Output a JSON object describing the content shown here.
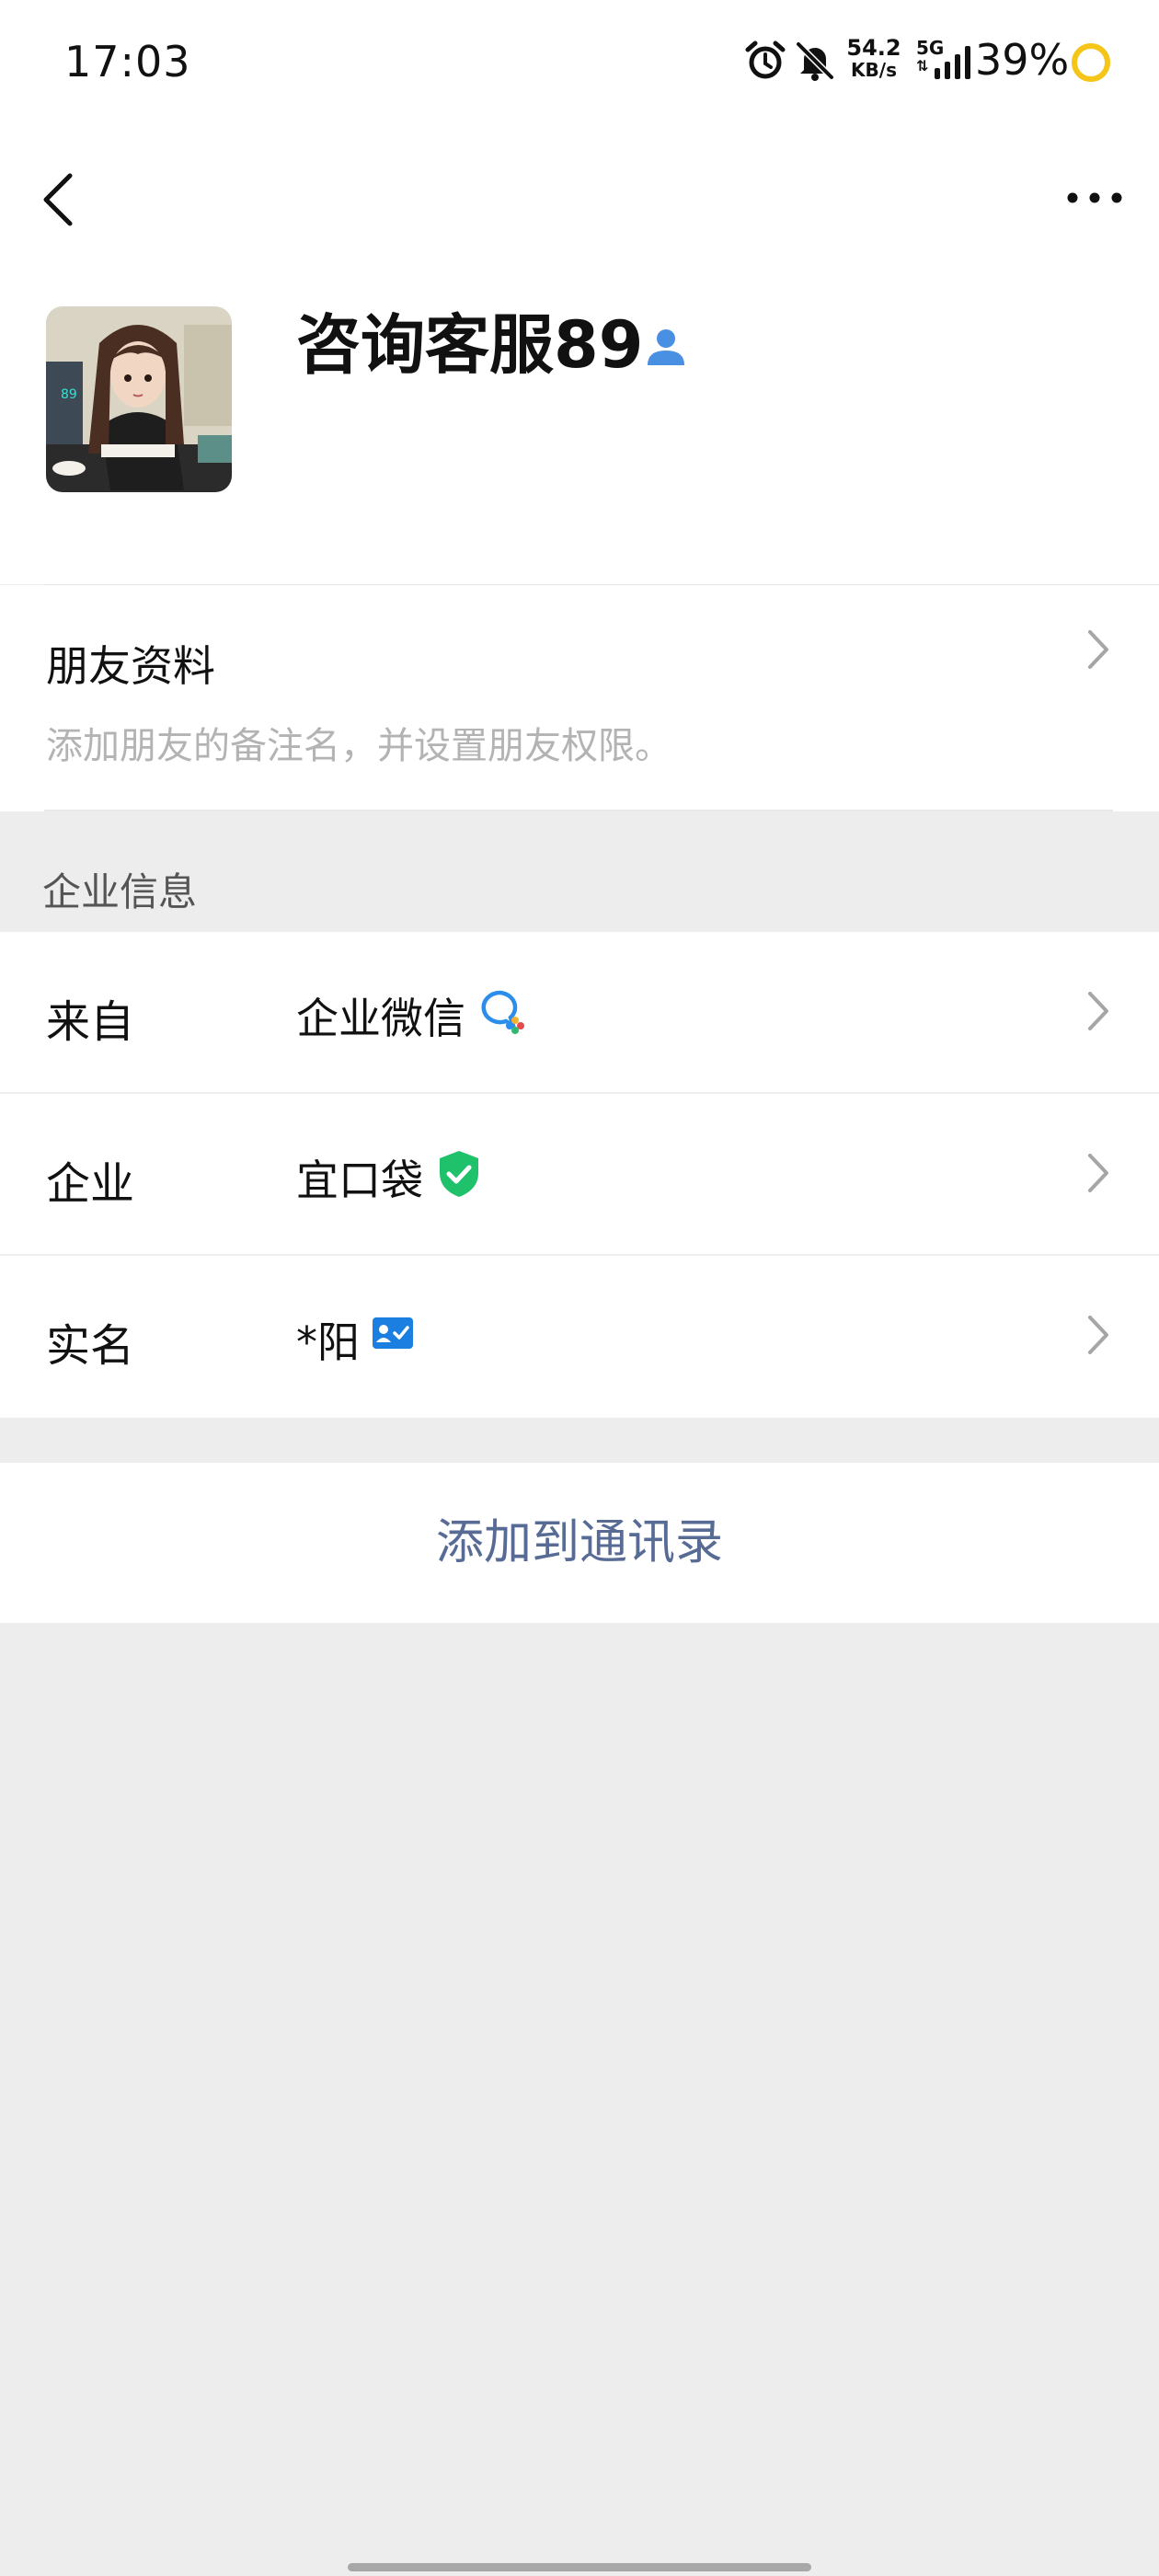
{
  "status_bar": {
    "time": "17:03",
    "net_speed_value": "54.2",
    "net_speed_unit": "KB/s",
    "network": "5G",
    "battery": "39%",
    "icons": [
      "alarm-icon",
      "bell-off-icon",
      "signal-icon",
      "battery-ring-icon"
    ],
    "battery_ring_color": "#f5c518"
  },
  "header": {
    "back_icon": "chevron-left-icon",
    "more_icon": "more-dots-icon"
  },
  "profile": {
    "name": "咨询客服89",
    "badge_icon": "person-icon",
    "badge_color": "#4a90e2",
    "avatar_text": "89"
  },
  "friend_info": {
    "title": "朋友资料",
    "description": "添加朋友的备注名，并设置朋友权限。"
  },
  "enterprise_section": {
    "label": "企业信息",
    "rows": [
      {
        "label": "来自",
        "value": "企业微信",
        "icon": "wecom-icon"
      },
      {
        "label": "企业",
        "value": "宜口袋",
        "icon": "verified-shield-icon"
      },
      {
        "label": "实名",
        "value": "*阳",
        "icon": "id-card-icon"
      }
    ]
  },
  "actions": {
    "add_contact": "添加到通讯录"
  },
  "colors": {
    "link": "#576b95",
    "verified": "#1fc16b",
    "background": "#ededed"
  }
}
